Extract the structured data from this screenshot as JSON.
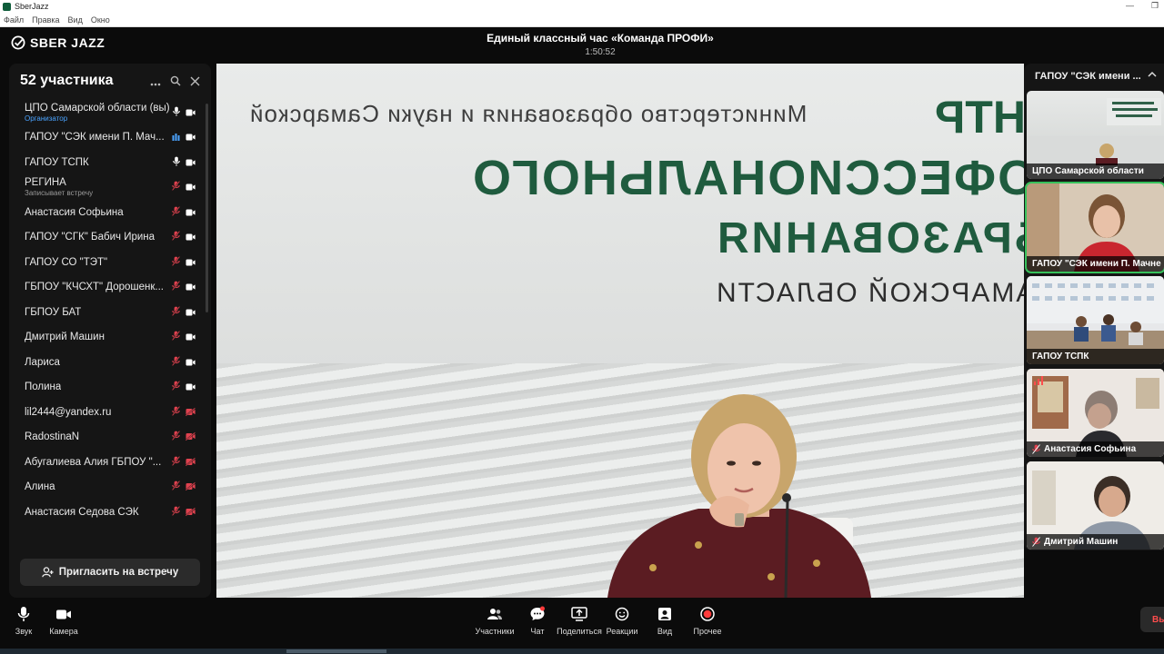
{
  "os": {
    "app_name": "SberJazz",
    "menu": [
      "Файл",
      "Правка",
      "Вид",
      "Окно"
    ],
    "controls": [
      "—",
      "❐"
    ]
  },
  "header": {
    "logo_text": "SBER JAZZ",
    "meeting_title": "Единый классный час «Команда ПРОФИ»",
    "timer": "1:50:52"
  },
  "participants": {
    "title": "52 участника",
    "invite_label": "Пригласить на встречу",
    "items": [
      {
        "name": "ЦПО Самарской области (вы)",
        "sub": "Организатор",
        "sub_type": "org",
        "mic": "on",
        "cam": "on"
      },
      {
        "name": "ГАПОУ \"СЭК имени П. Мач...",
        "sub": "",
        "sub_type": "",
        "mic": "speaking",
        "cam": "on"
      },
      {
        "name": "ГАПОУ ТСПК",
        "sub": "",
        "sub_type": "",
        "mic": "on",
        "cam": "on"
      },
      {
        "name": "РЕГИНА",
        "sub": "Записывает встречу",
        "sub_type": "rec",
        "mic": "off",
        "cam": "on"
      },
      {
        "name": "Анастасия Софьина",
        "sub": "",
        "sub_type": "",
        "mic": "off",
        "cam": "on"
      },
      {
        "name": "ГАПОУ \"СГК\" Бабич Ирина",
        "sub": "",
        "sub_type": "",
        "mic": "off",
        "cam": "on"
      },
      {
        "name": "ГАПОУ СО \"ТЭТ\"",
        "sub": "",
        "sub_type": "",
        "mic": "off",
        "cam": "on"
      },
      {
        "name": "ГБПОУ \"КЧСХТ\" Дорошенк...",
        "sub": "",
        "sub_type": "",
        "mic": "off",
        "cam": "on"
      },
      {
        "name": "ГБПОУ БАТ",
        "sub": "",
        "sub_type": "",
        "mic": "off",
        "cam": "on"
      },
      {
        "name": "Дмитрий Машин",
        "sub": "",
        "sub_type": "",
        "mic": "off",
        "cam": "on"
      },
      {
        "name": "Лариса",
        "sub": "",
        "sub_type": "",
        "mic": "off",
        "cam": "on"
      },
      {
        "name": "Полина",
        "sub": "",
        "sub_type": "",
        "mic": "off",
        "cam": "on"
      },
      {
        "name": "lil2444@yandex.ru",
        "sub": "",
        "sub_type": "",
        "mic": "off",
        "cam": "off"
      },
      {
        "name": "RadostinaN",
        "sub": "",
        "sub_type": "",
        "mic": "off",
        "cam": "off"
      },
      {
        "name": "Абугалиева Алия ГБПОУ \"...",
        "sub": "",
        "sub_type": "",
        "mic": "off",
        "cam": "off"
      },
      {
        "name": "Алина",
        "sub": "",
        "sub_type": "",
        "mic": "off",
        "cam": "off"
      },
      {
        "name": "Анастасия Седова СЭК",
        "sub": "",
        "sub_type": "",
        "mic": "off",
        "cam": "off"
      }
    ]
  },
  "main_video": {
    "sign_line1": "Министерство образования и науки Самарской",
    "sign_line2": "ЦЕНТР",
    "sign_line3": "ПРОФЕССИОНАЛЬНОГО",
    "sign_line4": "ОБРАЗОВАНИЯ",
    "sign_line5": "САМАРСКОЙ ОБЛАСТИ"
  },
  "thumbnails": {
    "header": "ГАПОУ \"СЭК имени ...",
    "items": [
      {
        "label": "ЦПО Самарской области",
        "mic": "none",
        "active": false
      },
      {
        "label": "ГАПОУ \"СЭК имени П. Мачне",
        "mic": "none",
        "active": true
      },
      {
        "label": "ГАПОУ ТСПК",
        "mic": "none",
        "active": false
      },
      {
        "label": "Анастасия Софьина",
        "mic": "off",
        "active": false
      },
      {
        "label": "Дмитрий Машин",
        "mic": "off",
        "active": false
      }
    ]
  },
  "toolbar": {
    "sound": "Звук",
    "camera": "Камера",
    "participants": "Участники",
    "chat": "Чат",
    "share": "Поделиться",
    "reactions": "Реакции",
    "view": "Вид",
    "more": "Прочее",
    "leave": "Вы"
  },
  "colors": {
    "accent_green": "#36c15b",
    "muted_red": "#e0424f",
    "organizer_blue": "#4aa3ff",
    "record_red": "#ff3b3b"
  }
}
